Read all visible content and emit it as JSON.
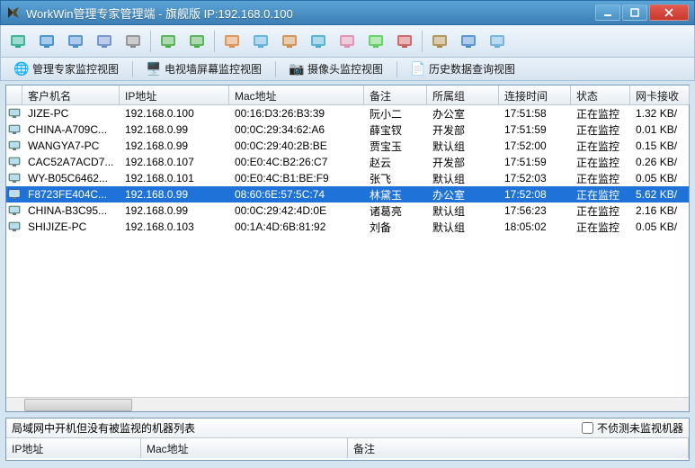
{
  "window": {
    "title": "WorkWin管理专家管理端 - 旗舰版 IP:192.168.0.100"
  },
  "viewTabs": [
    {
      "label": "管理专家监控视图"
    },
    {
      "label": "电视墙屏幕监控视图"
    },
    {
      "label": "摄像头监控视图"
    },
    {
      "label": "历史数据查询视图"
    }
  ],
  "columns": {
    "name": "客户机名",
    "ip": "IP地址",
    "mac": "Mac地址",
    "remark": "备注",
    "group": "所属组",
    "time": "连接时间",
    "status": "状态",
    "net": "网卡接收"
  },
  "rows": [
    {
      "name": "JIZE-PC",
      "ip": "192.168.0.100",
      "mac": "00:16:D3:26:B3:39",
      "remark": "阮小二",
      "group": "办公室",
      "time": "17:51:58",
      "status": "正在监控",
      "net": "1.32 KB/",
      "selected": false
    },
    {
      "name": "CHINA-A709C...",
      "ip": "192.168.0.99",
      "mac": "00:0C:29:34:62:A6",
      "remark": "薛宝钗",
      "group": "开发部",
      "time": "17:51:59",
      "status": "正在监控",
      "net": "0.01 KB/",
      "selected": false
    },
    {
      "name": "WANGYA7-PC",
      "ip": "192.168.0.99",
      "mac": "00:0C:29:40:2B:BE",
      "remark": "贾宝玉",
      "group": "默认组",
      "time": "17:52:00",
      "status": "正在监控",
      "net": "0.15 KB/",
      "selected": false
    },
    {
      "name": "CAC52A7ACD7...",
      "ip": "192.168.0.107",
      "mac": "00:E0:4C:B2:26:C7",
      "remark": "赵云",
      "group": "开发部",
      "time": "17:51:59",
      "status": "正在监控",
      "net": "0.26 KB/",
      "selected": false
    },
    {
      "name": "WY-B05C6462...",
      "ip": "192.168.0.101",
      "mac": "00:E0:4C:B1:BE:F9",
      "remark": "张飞",
      "group": "默认组",
      "time": "17:52:03",
      "status": "正在监控",
      "net": "0.05 KB/",
      "selected": false
    },
    {
      "name": "F8723FE404C...",
      "ip": "192.168.0.99",
      "mac": "08:60:6E:57:5C:74",
      "remark": "林黛玉",
      "group": "办公室",
      "time": "17:52:08",
      "status": "正在监控",
      "net": "5.62 KB/",
      "selected": true
    },
    {
      "name": "CHINA-B3C95...",
      "ip": "192.168.0.99",
      "mac": "00:0C:29:42:4D:0E",
      "remark": "诸葛亮",
      "group": "默认组",
      "time": "17:56:23",
      "status": "正在监控",
      "net": "2.16 KB/",
      "selected": false
    },
    {
      "name": "SHIJIZE-PC",
      "ip": "192.168.0.103",
      "mac": "00:1A:4D:6B:81:92",
      "remark": "刘备",
      "group": "默认组",
      "time": "18:05:02",
      "status": "正在监控",
      "net": "0.05 KB/",
      "selected": false
    }
  ],
  "bottom": {
    "title": "局域网中开机但没有被监视的机器列表",
    "checkbox": "不侦测未监视机器",
    "cols": {
      "ip": "IP地址",
      "mac": "Mac地址",
      "remark": "备注"
    }
  },
  "toolbarIcons": [
    "users-icon",
    "computer-icon",
    "screen-icon",
    "display-icon",
    "settings-icon",
    "arrow-left-icon",
    "arrow-right-icon",
    "files-icon",
    "chat-icon",
    "logs-icon",
    "refresh-icon",
    "search-icon",
    "message-icon",
    "camera-icon",
    "lock-icon",
    "user-icon",
    "help-icon"
  ]
}
